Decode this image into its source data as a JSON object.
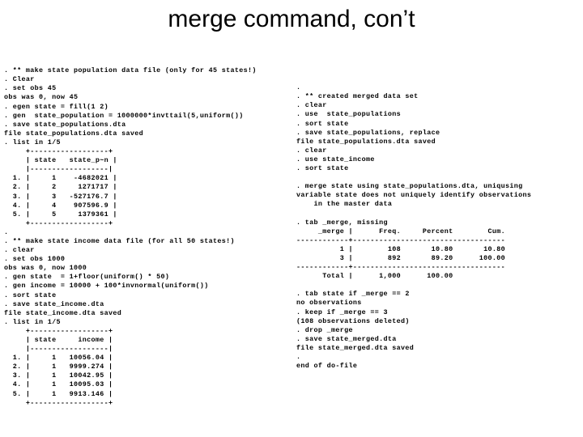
{
  "slide": {
    "title": "merge command, con’t",
    "left_column": {
      "lines": [
        ". ** make state population data file (only for 45 states!)",
        ". Clear",
        ". set obs 45",
        "obs was 0, now 45",
        ". egen state = fill(1 2)",
        ". gen  state_population = 1000000*invttail(5,uniform())",
        ". save state_populations.dta",
        "file state_populations.dta saved",
        ". list in 1/5",
        "     +------------------+",
        "     | state   state_p~n |",
        "     |------------------|",
        "  1. |     1    -4682021 |",
        "  2. |     2     1271717 |",
        "  3. |     3   -527176.7 |",
        "  4. |     4    907596.9 |",
        "  5. |     5     1379361 |",
        "     +------------------+",
        ".",
        ". ** make state income data file (for all 50 states!)",
        ". clear",
        ". set obs 1000",
        "obs was 0, now 1000",
        ". gen state  = 1+floor(uniform() * 50)",
        ". gen income = 10000 + 100*invnormal(uniform())",
        ". sort state",
        ". save state_income.dta",
        "file state_income.dta saved",
        ". list in 1/5",
        "     +------------------+",
        "     | state     income |",
        "     |------------------|",
        "  1. |     1   10056.04 |",
        "  2. |     1   9999.274 |",
        "  3. |     1   10042.95 |",
        "  4. |     1   10095.03 |",
        "  5. |     1   9913.146 |",
        "     +------------------+"
      ]
    },
    "right_column": {
      "lines": [
        ".",
        ". ** created merged data set",
        ". clear",
        ". use  state_populations",
        ". sort state",
        ". save state_populations, replace",
        "file state_populations.dta saved",
        ". clear",
        ". use state_income",
        ". sort state",
        "",
        ". merge state using state_populations.dta, uniqusing",
        "variable state does not uniquely identify observations",
        "    in the master data",
        "",
        ". tab _merge, missing",
        "     _merge |      Freq.     Percent        Cum.",
        "------------+-----------------------------------",
        "          1 |        108       10.80       10.80",
        "          3 |        892       89.20      100.00",
        "------------+-----------------------------------",
        "      Total |      1,000      100.00",
        "",
        ". tab state if _merge == 2",
        "no observations",
        ". keep if _merge == 3",
        "(108 observations deleted)",
        ". drop _merge",
        ". save state_merged.dta",
        "file state_merged.dta saved",
        ".",
        "end of do-file"
      ]
    }
  }
}
